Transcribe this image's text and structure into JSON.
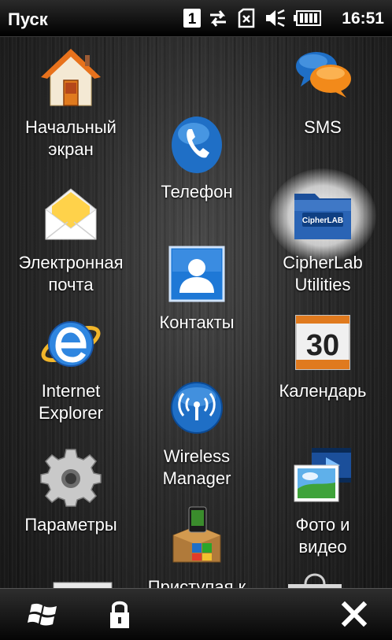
{
  "statusbar": {
    "title": "Пуск",
    "sim_badge": "1",
    "time": "16:51",
    "icons": [
      "sim-slot-icon",
      "data-sync-icon",
      "no-sim-icon",
      "volume-muted-icon",
      "battery-icon"
    ]
  },
  "tiles": {
    "home": {
      "label": "Начальный\nэкран",
      "icon": "home-icon"
    },
    "sms": {
      "label": "SMS",
      "icon": "speech-bubbles-icon"
    },
    "phone": {
      "label": "Телефон",
      "icon": "phone-icon"
    },
    "email": {
      "label": "Электронная\nпочта",
      "icon": "envelope-icon"
    },
    "cipherlab": {
      "label": "CipherLab\nUtilities",
      "icon": "cipherlab-folder-icon",
      "badge": "CipherLAB"
    },
    "contacts": {
      "label": "Контакты",
      "icon": "contacts-icon"
    },
    "ie": {
      "label": "Internet\nExplorer",
      "icon": "internet-explorer-icon"
    },
    "calendar": {
      "label": "Календарь",
      "icon": "calendar-icon",
      "day": "30"
    },
    "wireless": {
      "label": "Wireless\nManager",
      "icon": "wireless-icon"
    },
    "settings": {
      "label": "Параметры",
      "icon": "gear-icon"
    },
    "photos": {
      "label": "Фото и\nвидео",
      "icon": "photo-video-icon"
    },
    "getting_started": {
      "label": "Приступая к",
      "icon": "getting-started-icon"
    }
  },
  "bottombar": {
    "icons": [
      "windows-flag-icon",
      "lock-icon",
      "close-icon"
    ]
  },
  "colors": {
    "background": "#1e1e1e",
    "text": "#ffffff",
    "accent_blue": "#1f6fc6",
    "highlight_glow": "#ffffff"
  }
}
